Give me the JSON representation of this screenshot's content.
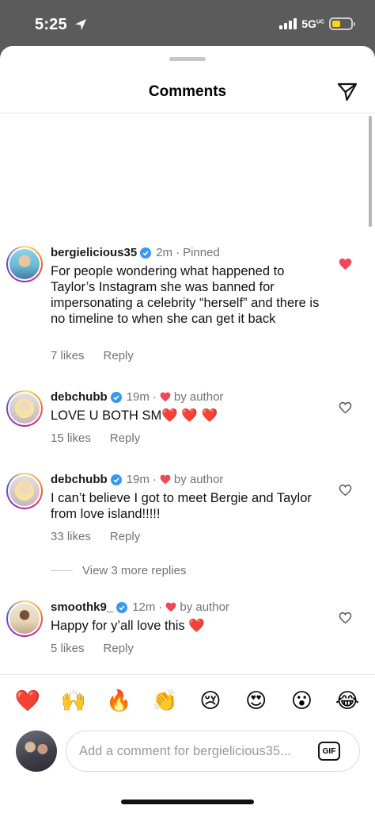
{
  "status_bar": {
    "time": "5:25",
    "network": "5G",
    "network_sub": "UC"
  },
  "header": {
    "title": "Comments"
  },
  "comments": [
    {
      "username": "bergielicious35",
      "time": "2m",
      "tag": "Pinned",
      "text": "For people wondering what happened to Taylor’s Instagram she was banned for impersonating a celebrity “herself” and there is no timeline to when she can get it back",
      "likes": "7 likes",
      "reply": "Reply",
      "liked": true
    },
    {
      "username": "debchubb",
      "time": "19m",
      "tag": "by author",
      "text": "LOVE U BOTH SM❤️ ❤️ ❤️",
      "likes": "15 likes",
      "reply": "Reply",
      "liked": false
    },
    {
      "username": "debchubb",
      "time": "19m",
      "tag": "by author",
      "text": "I can’t believe I got to meet Bergie and Taylor from love island!!!!!",
      "likes": "33 likes",
      "reply": "Reply",
      "liked": false
    },
    {
      "username": "smoothk9_",
      "time": "12m",
      "tag": "by author",
      "text": "Happy for y’all love this ❤️",
      "likes": "5 likes",
      "reply": "Reply",
      "liked": false
    }
  ],
  "view_replies": "View 3 more replies",
  "emoji_bar": [
    "❤️",
    "🙌",
    "🔥",
    "👏",
    "😢",
    "😍",
    "😮",
    "😂"
  ],
  "composer": {
    "placeholder": "Add a comment for bergielicious35...",
    "gif_label": "GIF"
  },
  "colors": {
    "like_red": "#ed4956",
    "verified_blue": "#3897f0",
    "meta_gray": "#737373"
  }
}
